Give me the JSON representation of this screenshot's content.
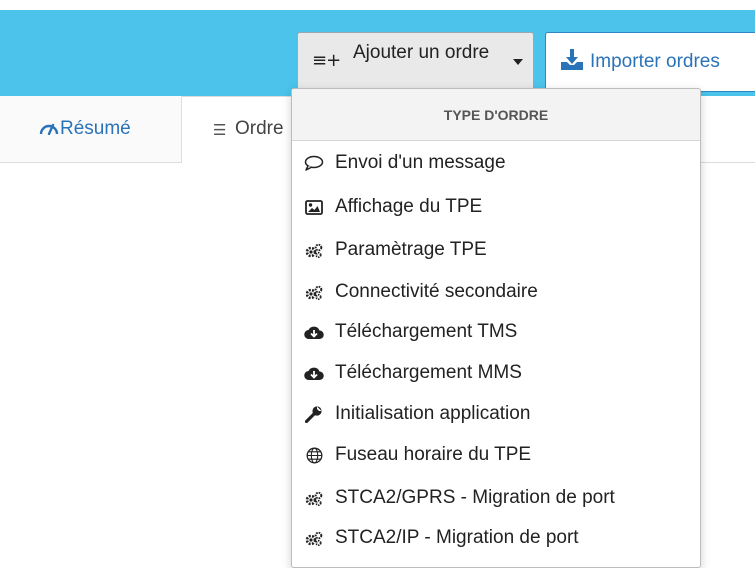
{
  "toolbar": {
    "add_order_label": "Ajouter un ordre",
    "add_order_icon": "list-plus-icon",
    "import_label": "Importer ordres",
    "import_icon": "download-tray-icon"
  },
  "tabs": [
    {
      "label": "Résumé",
      "icon": "gauge-icon"
    },
    {
      "label": "Ordre",
      "icon": "list-icon"
    }
  ],
  "dropdown": {
    "header": "TYPE D'ORDRE",
    "items": [
      {
        "label": "Envoi d'un message",
        "icon": "speech-bubble-icon"
      },
      {
        "label": "Affichage du TPE",
        "icon": "image-icon"
      },
      {
        "label": "Paramètrage TPE",
        "icon": "cogs-icon"
      },
      {
        "label": "Connectivité secondaire",
        "icon": "cogs-icon"
      },
      {
        "label": "Téléchargement TMS",
        "icon": "cloud-download-icon"
      },
      {
        "label": "Téléchargement MMS",
        "icon": "cloud-download-icon"
      },
      {
        "label": "Initialisation application",
        "icon": "wrench-icon"
      },
      {
        "label": "Fuseau horaire du TPE",
        "icon": "globe-icon"
      },
      {
        "label": "STCA2/GPRS - Migration de port",
        "icon": "cogs-icon"
      },
      {
        "label": "STCA2/IP - Migration de port",
        "icon": "cogs-icon"
      }
    ]
  },
  "colors": {
    "topbar": "#4cc3ea",
    "link_blue": "#2a73b8"
  }
}
